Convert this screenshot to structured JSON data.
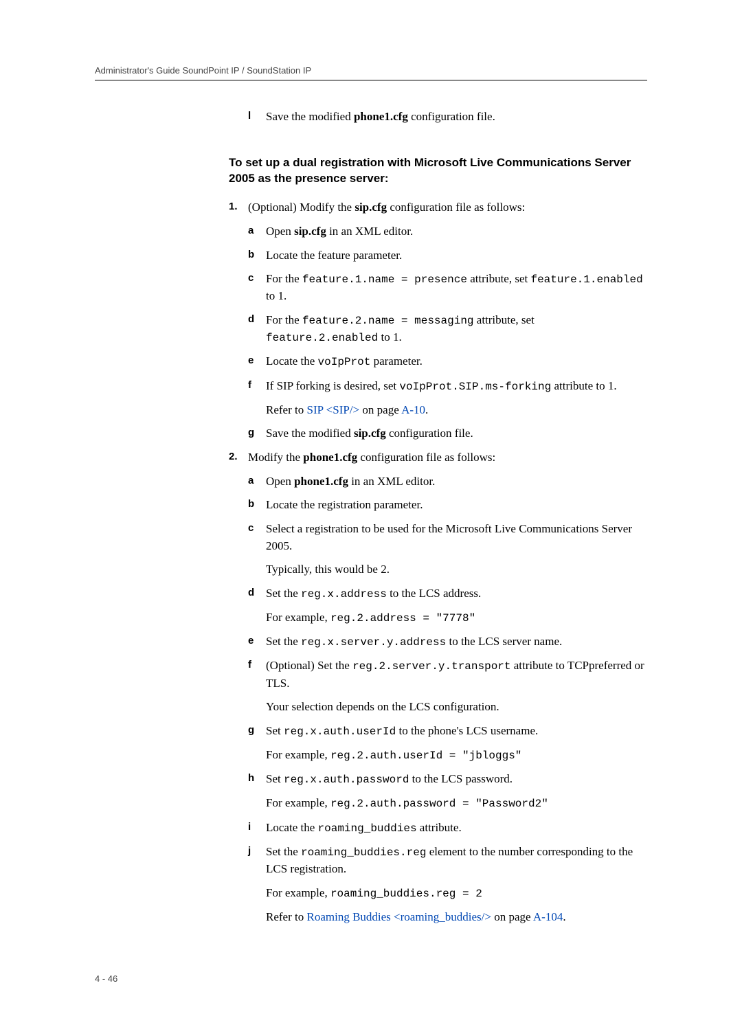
{
  "header": "Administrator's Guide SoundPoint IP / SoundStation IP",
  "intro_marker": "l",
  "intro_text": "Save the modified <b>phone1.cfg</b> configuration file.",
  "heading": "To set up a dual registration with Microsoft Live Communications Server 2005 as the presence server:",
  "step1_marker": "1.",
  "step1_text": "(Optional) Modify the <b>sip.cfg</b> configuration file as follows:",
  "s1a_m": "a",
  "s1a": "Open <b>sip.cfg</b> in an XML editor.",
  "s1b_m": "b",
  "s1b": "Locate the feature parameter.",
  "s1c_m": "c",
  "s1c": "For the <c>feature.1.name = presence</c> attribute, set <c>feature.1.enabled</c> to 1.",
  "s1d_m": "d",
  "s1d": "For the <c>feature.2.name = messaging</c> attribute, set <c>feature.2.enabled</c> to 1.",
  "s1e_m": "e",
  "s1e": "Locate the <c>voIpProt</c> parameter.",
  "s1f_m": "f",
  "s1f": "If SIP forking is desired, set <c>voIpProt.SIP.ms-forking</c> attribute to 1.",
  "s1f_refer": "Refer to <l>SIP &lt;SIP/&gt;</l> on page <l>A-10</l>.",
  "s1g_m": "g",
  "s1g": "Save the modified <b>sip.cfg</b> configuration file.",
  "step2_marker": "2.",
  "step2_text": "Modify the <b>phone1.cfg</b> configuration file as follows:",
  "s2a_m": "a",
  "s2a": "Open <b>phone1.cfg</b> in an XML editor.",
  "s2b_m": "b",
  "s2b": "Locate the registration parameter.",
  "s2c_m": "c",
  "s2c": "Select a registration to be used for the Microsoft Live Communications Server 2005.",
  "s2c_extra": "Typically, this would be 2.",
  "s2d_m": "d",
  "s2d": "Set the <c>reg.x.address</c> to the LCS address.",
  "s2d_extra": "For example, <c>reg.2.address = \"7778\"</c>",
  "s2e_m": "e",
  "s2e": "Set the <c>reg.x.server.y.address</c> to the LCS server name.",
  "s2f_m": "f",
  "s2f": "(Optional) Set the <c>reg.2.server.y.transport</c> attribute to TCPpreferred or TLS.",
  "s2f_extra": "Your selection depends on the LCS configuration.",
  "s2g_m": "g",
  "s2g": "Set <c>reg.x.auth.userId</c> to the phone's LCS username.",
  "s2g_extra": "For example, <c>reg.2.auth.userId = \"jbloggs\"</c>",
  "s2h_m": "h",
  "s2h": "Set <c>reg.x.auth.password</c> to the LCS password.",
  "s2h_extra": "For example, <c>reg.2.auth.password = \"Password2\"</c>",
  "s2i_m": "i",
  "s2i": "Locate the <c>roaming_buddies</c> attribute.",
  "s2j_m": "j",
  "s2j": "Set the <c>roaming_buddies.reg</c> element to the number corresponding to the LCS registration.",
  "s2j_extra1": "For example, <c>roaming_buddies.reg = 2</c>",
  "s2j_extra2": "Refer to <l>Roaming Buddies &lt;roaming_buddies/&gt;</l> on page <l>A-104</l>.",
  "page_number": "4 - 46"
}
